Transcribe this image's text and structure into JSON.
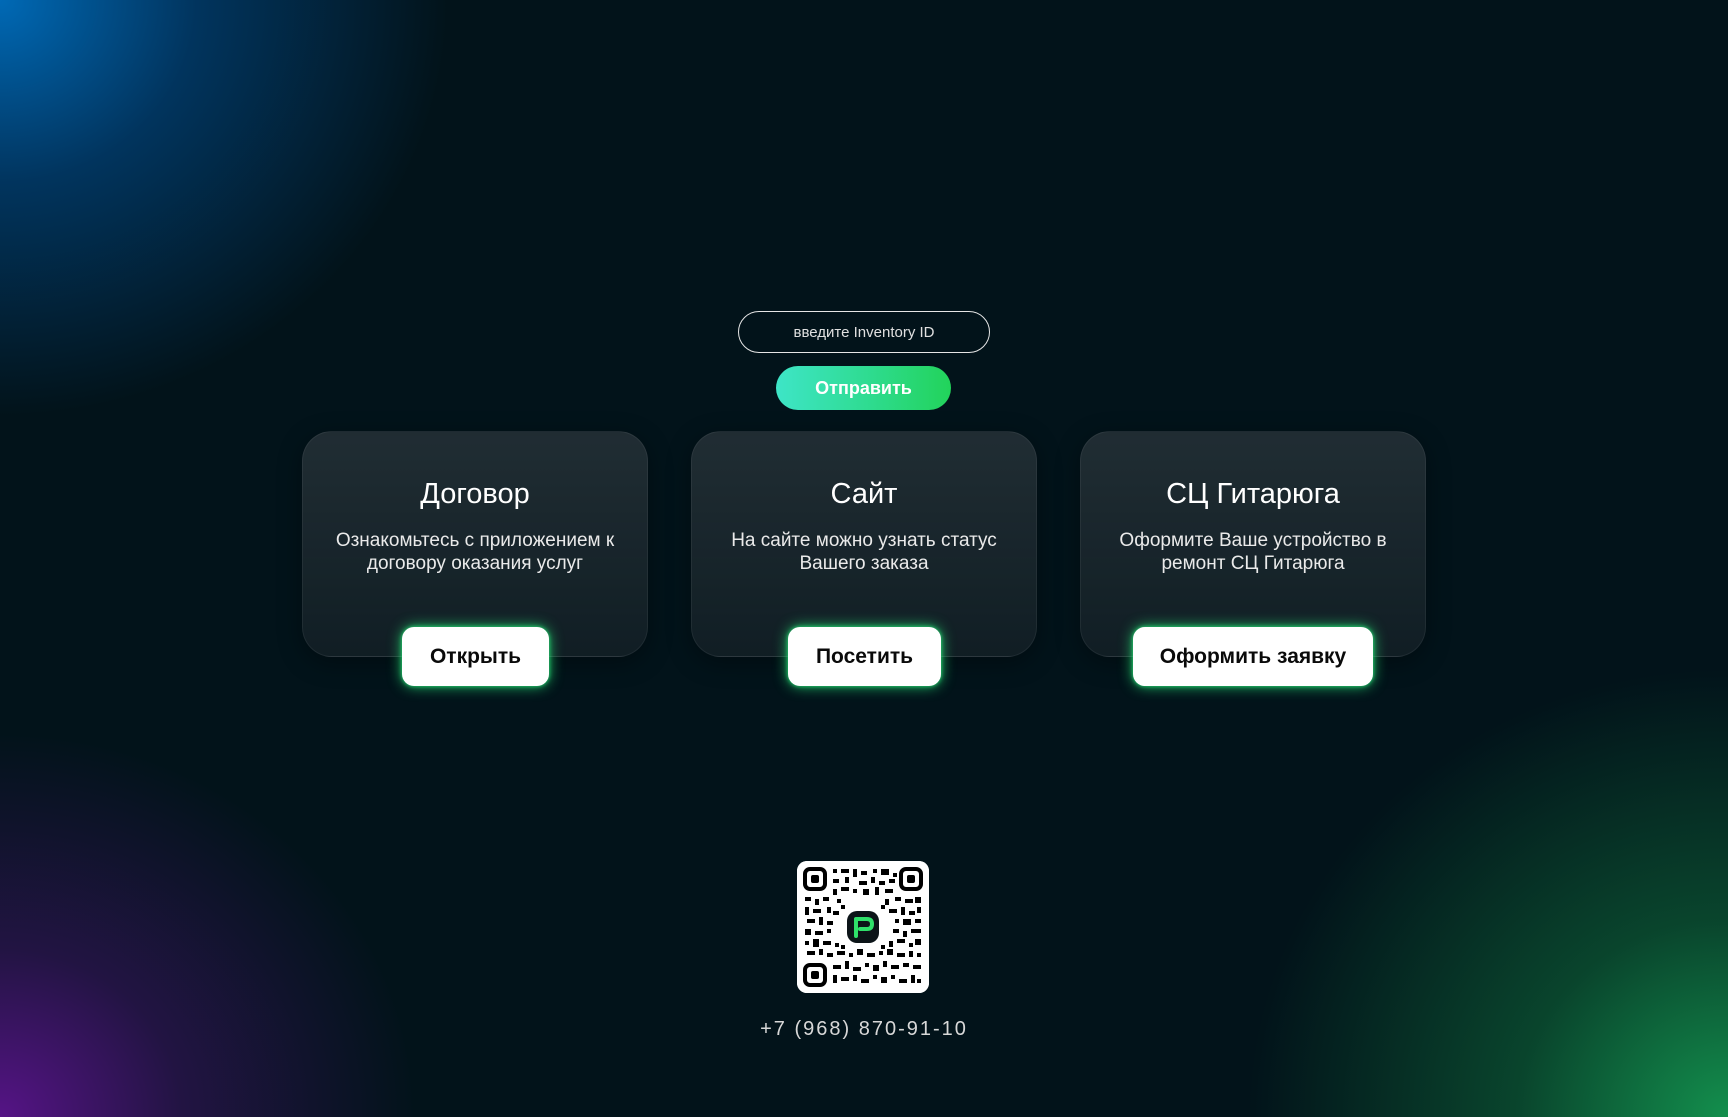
{
  "search": {
    "placeholder": "введите Inventory ID",
    "submit_label": "Отправить"
  },
  "cards": [
    {
      "title": "Договор",
      "description": "Ознакомьтесь с приложением к договору оказания услуг",
      "button_label": "Открыть"
    },
    {
      "title": "Сайт",
      "description": "На сайте можно узнать статус Вашего заказа",
      "button_label": "Посетить"
    },
    {
      "title": "СЦ Гитарюга",
      "description": "Оформите Ваше устройство в ремонт СЦ Гитарюга",
      "button_label": "Оформить заявку"
    }
  ],
  "footer": {
    "phone": "+7 (968) 870-91-10",
    "qr_icon": "qr-code-icon"
  },
  "colors": {
    "accent_start": "#3ee5c7",
    "accent_end": "#22d35a",
    "background": "#02131a",
    "glow": "#28e678"
  }
}
